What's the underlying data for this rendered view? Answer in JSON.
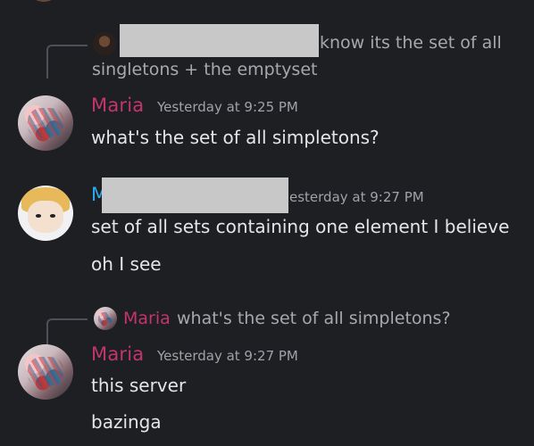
{
  "reply_1": {
    "text_after_redaction": "know its the set of all",
    "text_line_2": "singletons + the emptyset"
  },
  "message_1": {
    "author": "Maria",
    "timestamp": "Yesterday at 9:25 PM",
    "lines": [
      "what's the set of all simpleton s?"
    ]
  },
  "message_2": {
    "author_initial": "M",
    "timestamp_partial": "esterday at 9:27 PM",
    "lines": [
      "set of all sets containing one element I believe",
      "oh I see"
    ]
  },
  "reply_2": {
    "author": "Maria",
    "text": "what's the set of all simpletons?"
  },
  "message_3": {
    "author": "Maria",
    "timestamp": "Yesterday at 9:27 PM",
    "lines": [
      "this server",
      "bazinga"
    ]
  },
  "colors": {
    "background": "#1e1f22",
    "maria_name": "#c3356e",
    "blue_name": "#2ea8ef",
    "message_text": "#e3e5e8",
    "muted_text": "#9ea2a9"
  }
}
